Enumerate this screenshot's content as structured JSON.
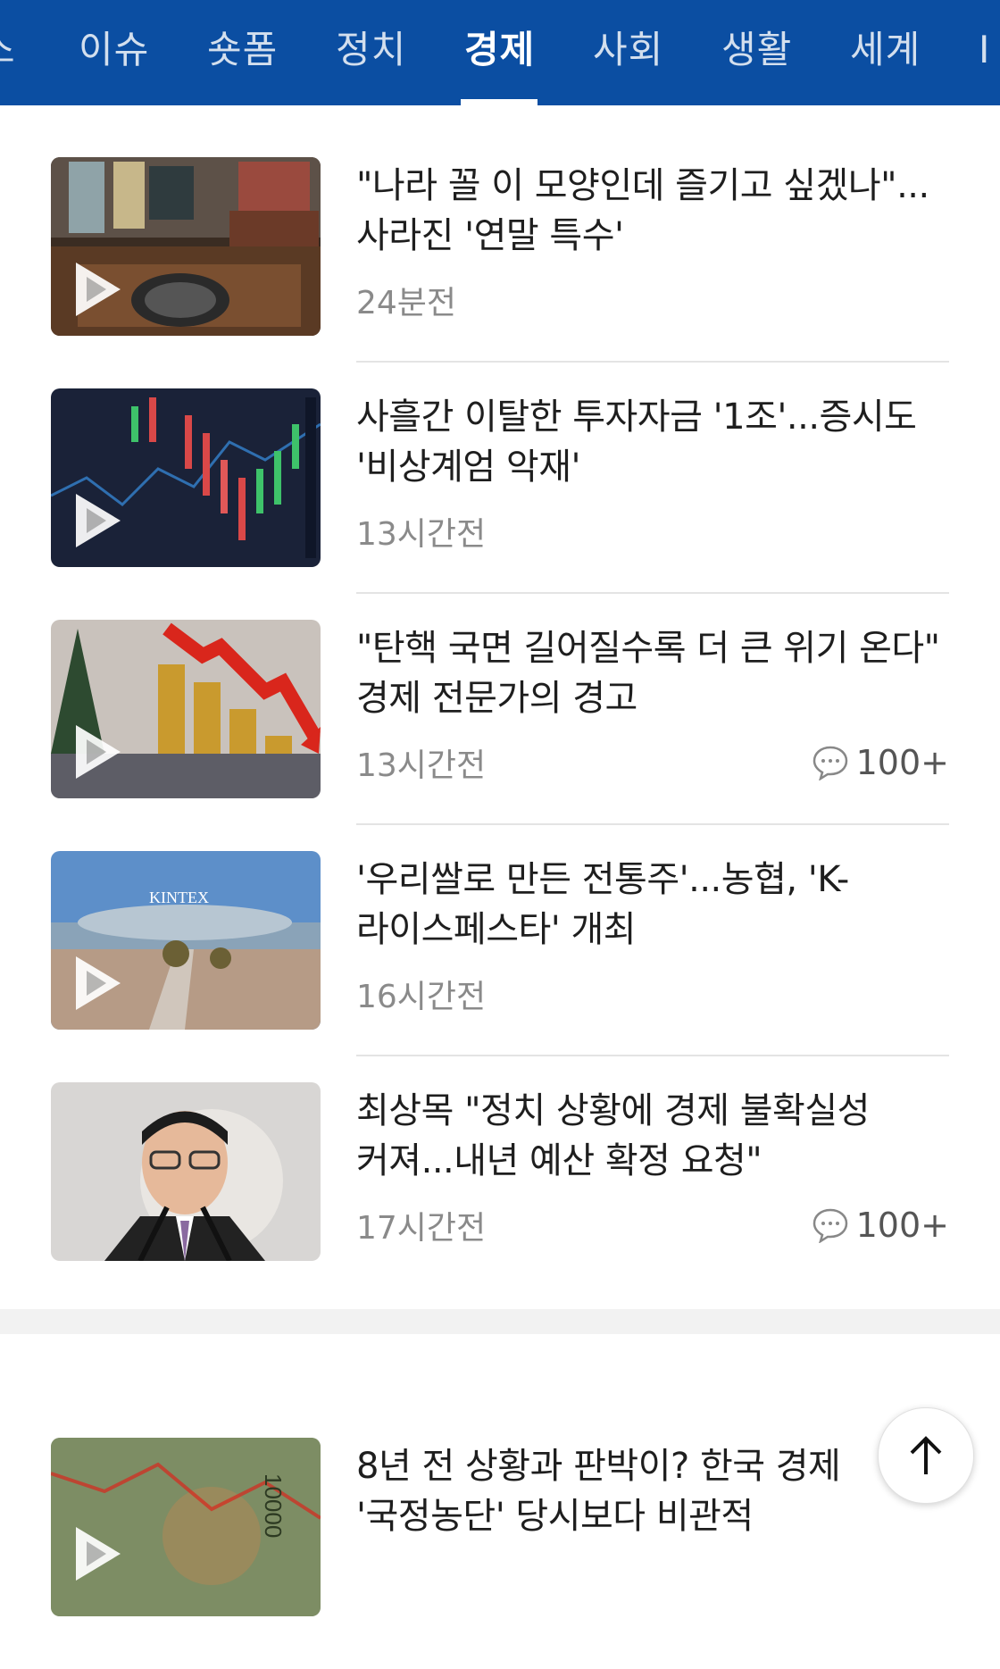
{
  "nav": {
    "tabs": [
      {
        "label": "스"
      },
      {
        "label": "이슈"
      },
      {
        "label": "숏폼"
      },
      {
        "label": "정치"
      },
      {
        "label": "경제"
      },
      {
        "label": "사회"
      },
      {
        "label": "생활"
      },
      {
        "label": "세계"
      },
      {
        "label": "I"
      }
    ],
    "active_tab": "경제"
  },
  "articles": [
    {
      "title": "\"나라 꼴 이 모양인데 즐기고 싶겠나\"... 사라진 '연말 특수'",
      "time": "24분전",
      "comments": null
    },
    {
      "title": "사흘간 이탈한 투자자금 '1조'...증시도 '비상계엄 악재'",
      "time": "13시간전",
      "comments": null
    },
    {
      "title": "\"탄핵 국면 길어질수록 더 큰 위기 온다\" 경제 전문가의 경고",
      "time": "13시간전",
      "comments": "100+"
    },
    {
      "title": "'우리쌀로 만든 전통주'...농협, 'K-라이스페스타' 개최",
      "time": "16시간전",
      "comments": null
    },
    {
      "title": "최상목 \"정치 상황에 경제 불확실성 커져...내년 예산 확정 요청\"",
      "time": "17시간전",
      "comments": "100+"
    },
    {
      "title": "8년 전 상황과 판박이? 한국 경제 '국정농단' 당시보다 비관적",
      "time": "",
      "comments": null
    }
  ],
  "thumbnail_text": {
    "kintex_sign": "KINTEX",
    "banknote_value": "10000"
  },
  "colors": {
    "nav_bg": "#0b4ea2",
    "divider": "#e4e4e4",
    "time_text": "#8a8a8a"
  }
}
